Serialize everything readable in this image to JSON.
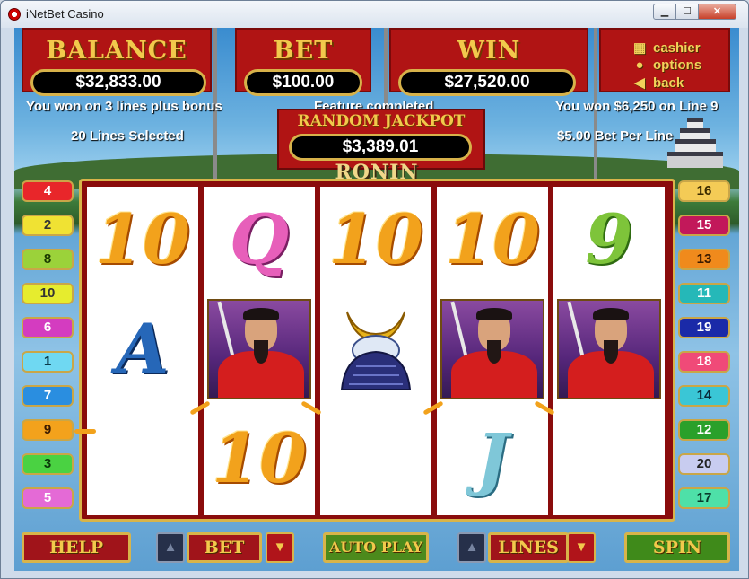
{
  "window": {
    "title": "iNetBet Casino"
  },
  "game": {
    "logo": "RONIN",
    "balance": {
      "caption": "BALANCE",
      "value": "$32,833.00"
    },
    "bet": {
      "caption": "BET",
      "value": "$100.00"
    },
    "win": {
      "caption": "WIN",
      "value": "$27,520.00"
    },
    "jackpot": {
      "caption": "RANDOM JACKPOT",
      "value": "$3,389.01"
    },
    "messages": {
      "left_top": "You won on 3 lines plus bonus",
      "left_bottom": "20 Lines Selected",
      "center": "Feature completed",
      "right_top": "You won $6,250 on Line 9",
      "right_bottom": "$5.00 Bet Per Line"
    },
    "menu": [
      {
        "label": "cashier",
        "icon": "cashier-icon"
      },
      {
        "label": "options",
        "icon": "options-icon"
      },
      {
        "label": "back",
        "icon": "back-arrow-icon"
      }
    ],
    "left_lines": [
      "4",
      "2",
      "8",
      "10",
      "6",
      "1",
      "7",
      "9",
      "3",
      "5"
    ],
    "right_lines": [
      "16",
      "15",
      "13",
      "11",
      "19",
      "18",
      "14",
      "12",
      "20",
      "17"
    ],
    "reels": [
      [
        "10",
        "A",
        ""
      ],
      [
        "Q",
        "samurai",
        "10"
      ],
      [
        "10",
        "helmet",
        ""
      ],
      [
        "10",
        "samurai",
        "J"
      ],
      [
        "9",
        "samurai",
        ""
      ]
    ],
    "buttons": {
      "help": "HELP",
      "bet": "BET",
      "autoplay": "AUTO PLAY",
      "lines": "LINES",
      "spin": "SPIN"
    },
    "colors": {
      "banner_red": "#b01414",
      "gold": "#f2c94c",
      "reel_frame": "#8a0c0c"
    }
  }
}
